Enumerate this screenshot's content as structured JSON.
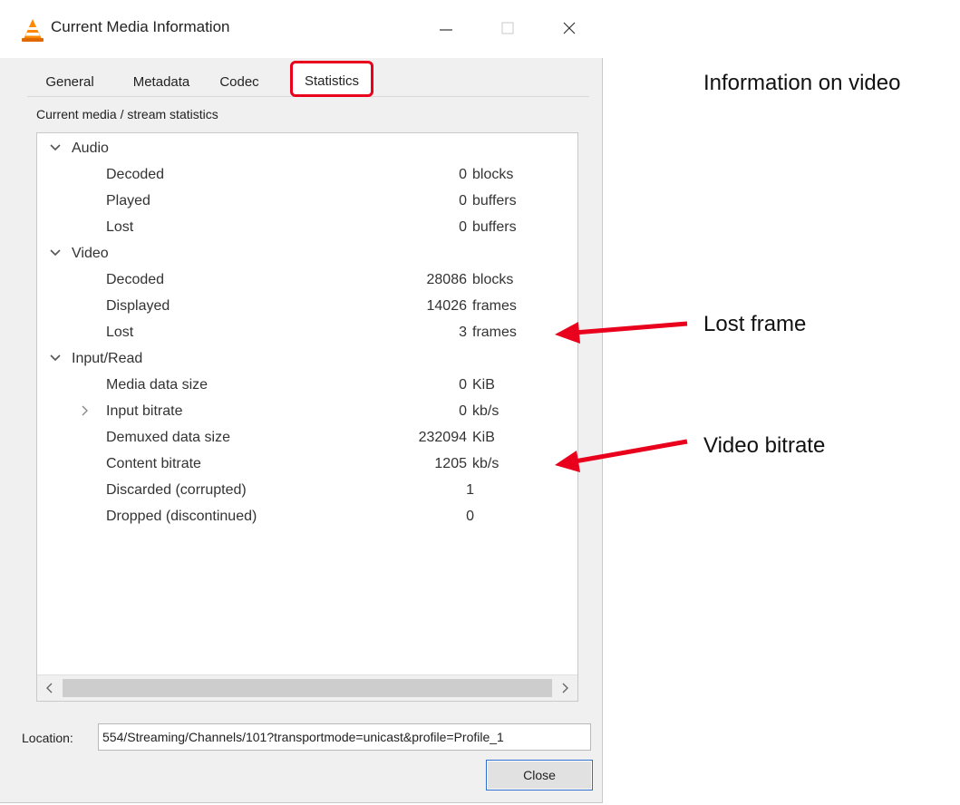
{
  "window": {
    "title": "Current Media Information",
    "buttons": {
      "minimize": "minimize",
      "maximize": "maximize",
      "close": "close"
    }
  },
  "tabs": [
    {
      "label": "General",
      "accesskey": "G"
    },
    {
      "label": "Metadata",
      "accesskey": "M"
    },
    {
      "label": "Codec",
      "accesskey": "d"
    },
    {
      "label": "Statistics",
      "accesskey": "S",
      "selected": true
    }
  ],
  "panel": {
    "caption": "Current media / stream statistics",
    "groups": [
      {
        "label": "Audio",
        "items": [
          {
            "label": "Decoded",
            "value": "0",
            "unit": "blocks"
          },
          {
            "label": "Played",
            "value": "0",
            "unit": "buffers"
          },
          {
            "label": "Lost",
            "value": "0",
            "unit": "buffers"
          }
        ]
      },
      {
        "label": "Video",
        "items": [
          {
            "label": "Decoded",
            "value": "28086",
            "unit": "blocks"
          },
          {
            "label": "Displayed",
            "value": "14026",
            "unit": "frames"
          },
          {
            "label": "Lost",
            "value": "3",
            "unit": "frames"
          }
        ]
      },
      {
        "label": "Input/Read",
        "items": [
          {
            "label": "Media data size",
            "value": "0",
            "unit": "KiB"
          },
          {
            "label": "Input bitrate",
            "value": "0",
            "unit": "kb/s"
          },
          {
            "label": "Demuxed data size",
            "value": "232094",
            "unit": "KiB"
          },
          {
            "label": "Content bitrate",
            "value": "1205",
            "unit": "kb/s"
          },
          {
            "label": "Discarded (corrupted)",
            "value": "1",
            "unit": ""
          },
          {
            "label": "Dropped (discontinued)",
            "value": "0",
            "unit": ""
          }
        ]
      }
    ]
  },
  "location": {
    "label": "Location:",
    "value": "554/Streaming/Channels/101?transportmode=unicast&profile=Profile_1"
  },
  "close_button": {
    "label": "Close"
  },
  "annotations": {
    "info": "Information on video",
    "lost": "Lost frame",
    "bitrate": "Video bitrate"
  },
  "colors": {
    "annotation_red": "#e8001c",
    "dialog_bg": "#f0f0f0",
    "focus_blue": "#2d6fcf"
  }
}
